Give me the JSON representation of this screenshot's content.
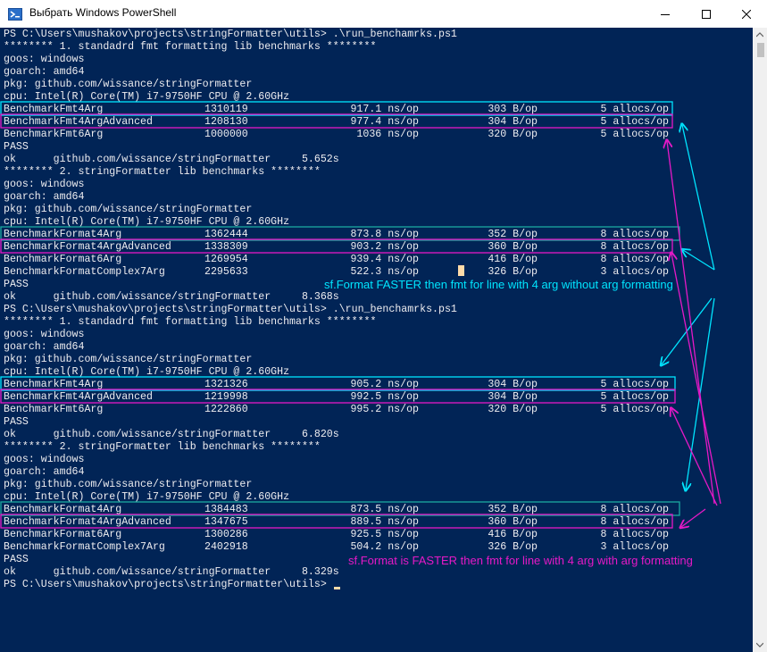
{
  "window": {
    "title": "Выбрать Windows PowerShell",
    "icon": "powershell-icon",
    "controls": {
      "minimize_icon": "minimize-icon",
      "maximize_icon": "maximize-icon",
      "close_icon": "close-icon"
    }
  },
  "colors": {
    "console_background": "#012456",
    "console_text": "#eeedf0",
    "cursor": "#fedba9",
    "highlight_cyan": "#00e5ff",
    "highlight_magenta": "#e619c7",
    "highlight_teal": "#1ba8a0"
  },
  "console": {
    "lines": [
      {
        "text": "PS C:\\Users\\mushakov\\projects\\stringFormatter\\utils> .\\run_benchamrks.ps1"
      },
      {
        "text": "******** 1. standadrd fmt formatting lib benchmarks ********"
      },
      {
        "text": "goos: windows"
      },
      {
        "text": "goarch: amd64"
      },
      {
        "text": "pkg: github.com/wissance/stringFormatter"
      },
      {
        "text": "cpu: Intel(R) Core(TM) i7-9750HF CPU @ 2.60GHz"
      },
      {
        "name": "BenchmarkFmt4Arg",
        "n": "1310119",
        "ns": "917.1 ns/op",
        "b": "303 B/op",
        "allocs": "5 allocs/op"
      },
      {
        "name": "BenchmarkFmt4ArgAdvanced",
        "n": "1208130",
        "ns": "977.4 ns/op",
        "b": "304 B/op",
        "allocs": "5 allocs/op"
      },
      {
        "name": "BenchmarkFmt6Arg",
        "n": "1000000",
        "ns": "1036 ns/op",
        "b": "320 B/op",
        "allocs": "5 allocs/op"
      },
      {
        "text": "PASS"
      },
      {
        "text": "ok      github.com/wissance/stringFormatter     5.652s"
      },
      {
        "text": "******** 2. stringFormatter lib benchmarks ********"
      },
      {
        "text": "goos: windows"
      },
      {
        "text": "goarch: amd64"
      },
      {
        "text": "pkg: github.com/wissance/stringFormatter"
      },
      {
        "text": "cpu: Intel(R) Core(TM) i7-9750HF CPU @ 2.60GHz"
      },
      {
        "name": "BenchmarkFormat4Arg",
        "n": "1362444",
        "ns": "873.8 ns/op",
        "b": "352 B/op",
        "allocs": "8 allocs/op"
      },
      {
        "name": "BenchmarkFormat4ArgAdvanced",
        "n": "1338309",
        "ns": "903.2 ns/op",
        "b": "360 B/op",
        "allocs": "8 allocs/op"
      },
      {
        "name": "BenchmarkFormat6Arg",
        "n": "1269954",
        "ns": "939.4 ns/op",
        "b": "416 B/op",
        "allocs": "8 allocs/op"
      },
      {
        "name": "BenchmarkFormatComplex7Arg",
        "n": "2295633",
        "ns": "522.3 ns/op",
        "b": "326 B/op",
        "allocs": "3 allocs/op"
      },
      {
        "text": "PASS"
      },
      {
        "text": "ok      github.com/wissance/stringFormatter     8.368s"
      },
      {
        "text": "PS C:\\Users\\mushakov\\projects\\stringFormatter\\utils> .\\run_benchamrks.ps1"
      },
      {
        "text": "******** 1. standadrd fmt formatting lib benchmarks ********"
      },
      {
        "text": "goos: windows"
      },
      {
        "text": "goarch: amd64"
      },
      {
        "text": "pkg: github.com/wissance/stringFormatter"
      },
      {
        "text": "cpu: Intel(R) Core(TM) i7-9750HF CPU @ 2.60GHz"
      },
      {
        "name": "BenchmarkFmt4Arg",
        "n": "1321326",
        "ns": "905.2 ns/op",
        "b": "304 B/op",
        "allocs": "5 allocs/op"
      },
      {
        "name": "BenchmarkFmt4ArgAdvanced",
        "n": "1219998",
        "ns": "992.5 ns/op",
        "b": "304 B/op",
        "allocs": "5 allocs/op"
      },
      {
        "name": "BenchmarkFmt6Arg",
        "n": "1222860",
        "ns": "995.2 ns/op",
        "b": "320 B/op",
        "allocs": "5 allocs/op"
      },
      {
        "text": "PASS"
      },
      {
        "text": "ok      github.com/wissance/stringFormatter     6.820s"
      },
      {
        "text": "******** 2. stringFormatter lib benchmarks ********"
      },
      {
        "text": "goos: windows"
      },
      {
        "text": "goarch: amd64"
      },
      {
        "text": "pkg: github.com/wissance/stringFormatter"
      },
      {
        "text": "cpu: Intel(R) Core(TM) i7-9750HF CPU @ 2.60GHz"
      },
      {
        "name": "BenchmarkFormat4Arg",
        "n": "1384483",
        "ns": "873.5 ns/op",
        "b": "352 B/op",
        "allocs": "8 allocs/op"
      },
      {
        "name": "BenchmarkFormat4ArgAdvanced",
        "n": "1347675",
        "ns": "889.5 ns/op",
        "b": "360 B/op",
        "allocs": "8 allocs/op"
      },
      {
        "name": "BenchmarkFormat6Arg",
        "n": "1300286",
        "ns": "925.5 ns/op",
        "b": "416 B/op",
        "allocs": "8 allocs/op"
      },
      {
        "name": "BenchmarkFormatComplex7Arg",
        "n": "2402918",
        "ns": "504.2 ns/op",
        "b": "326 B/op",
        "allocs": "3 allocs/op"
      },
      {
        "text": "PASS"
      },
      {
        "text": "ok      github.com/wissance/stringFormatter     8.329s"
      },
      {
        "text": "PS C:\\Users\\mushakov\\projects\\stringFormatter\\utils> "
      }
    ]
  },
  "annotations": {
    "cyan_note": "sf.Format FASTER then fmt for line with 4 arg without arg formatting",
    "magenta_note": "sf.Format is FASTER then fmt for line with 4 arg with arg formatting"
  },
  "scrollbar": {
    "up_icon": "scroll-up-arrow-icon",
    "down_icon": "scroll-down-arrow-icon"
  }
}
